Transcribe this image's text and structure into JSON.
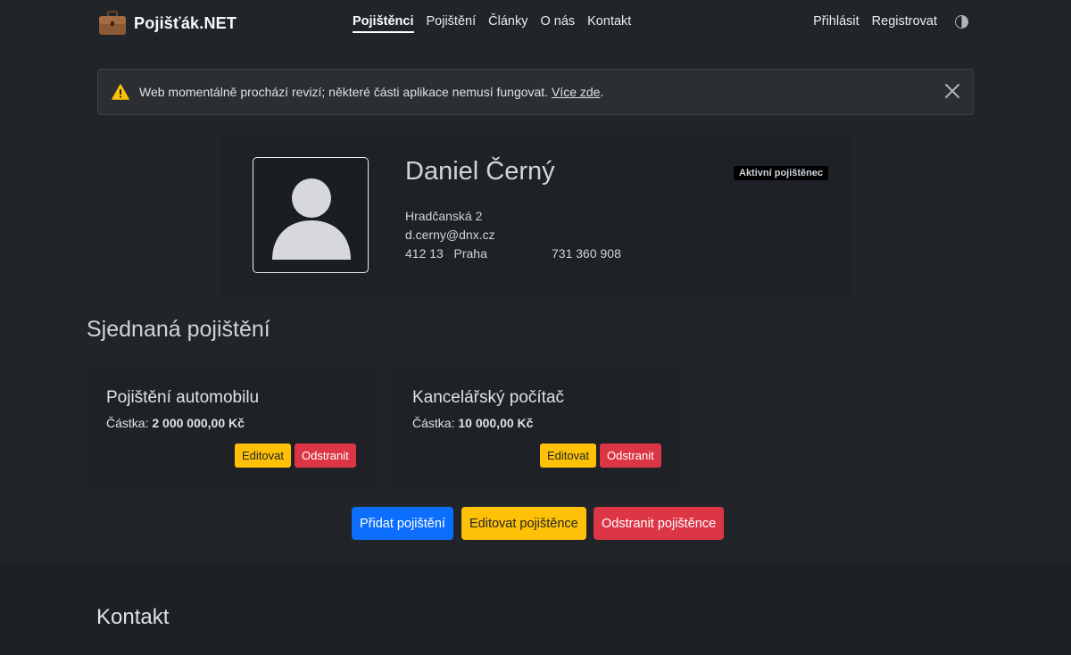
{
  "navbar": {
    "brand": "Pojišťák.NET",
    "brand_icon": "briefcase-icon",
    "links": [
      "Pojištěnci",
      "Pojištění",
      "Články",
      "O nás",
      "Kontakt"
    ],
    "active_link": "Pojištěnci",
    "login": "Přihlásit",
    "register": "Registrovat",
    "theme_icon": "contrast-icon"
  },
  "alert": {
    "text": "Web momentálně prochází revizí; některé části aplikace nemusí fungovat.",
    "link": "Více zde",
    "suffix": "."
  },
  "profile": {
    "name": "Daniel Černý",
    "badge": "Aktivní pojištěnec",
    "street": "Hradčanská 2",
    "email": "d.cerny@dnx.cz",
    "zip": "412 13",
    "city": "Praha",
    "phone": "731 360 908"
  },
  "insurances_section": {
    "title": "Sjednaná pojištění",
    "items": [
      {
        "title": "Pojištění automobilu",
        "amount_label": "Částka:",
        "amount": "2 000 000,00 Kč",
        "edit": "Editovat",
        "remove": "Odstranit"
      },
      {
        "title": "Kancelářský počítač",
        "amount_label": "Částka:",
        "amount": "10 000,00 Kč",
        "edit": "Editovat",
        "remove": "Odstranit"
      }
    ]
  },
  "actions": {
    "add": "Přidat pojištění",
    "edit_insured": "Editovat pojištěnce",
    "remove_insured": "Odstranit pojištěnce"
  },
  "footer": {
    "title": "Kontakt"
  },
  "colors": {
    "background": "#212529",
    "primary": "#0d6efd",
    "warning": "#ffc107",
    "danger": "#dc3545"
  }
}
